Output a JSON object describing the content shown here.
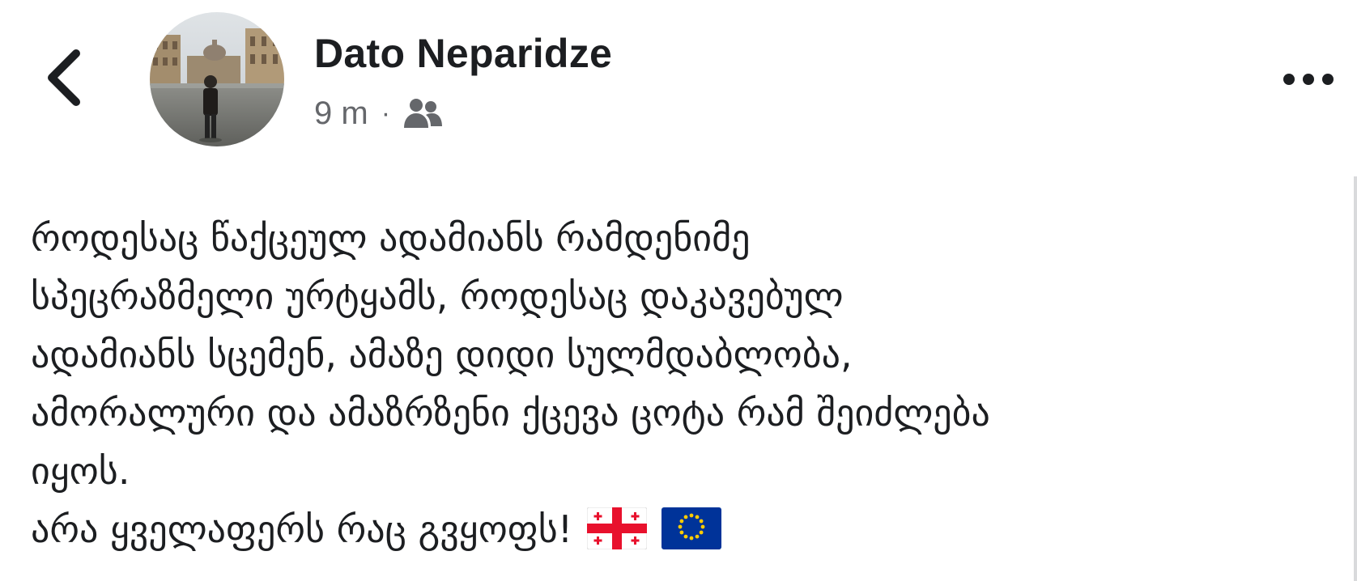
{
  "post": {
    "author": {
      "name": "Dato Neparidze"
    },
    "meta": {
      "time": "9 m",
      "separator": "·",
      "audience_icon": "friends-icon"
    },
    "icons": {
      "back": "chevron-left-icon",
      "more": "more-horizontal-icon"
    },
    "body_lines": [
      "როდესაც წაქცეულ ადამიანს რამდენიმე",
      "სპეცრაზმელი ურტყამს, როდესაც დაკავებულ",
      "ადამიანს სცემენ, ამაზე დიდი სულმდაბლობა,",
      "ამორალური და ამაზრზენი ქცევა ცოტა რამ შეიძლება",
      "იყოს.",
      "არა ყველაფერს რაც გვყოფს!"
    ],
    "flags": [
      "georgia-flag-icon",
      "eu-flag-icon"
    ]
  },
  "colors": {
    "text": "#1c1e21",
    "secondary_text": "#65676b",
    "background": "#ffffff",
    "flag_red": "#e8112d",
    "eu_blue": "#003399",
    "eu_gold": "#ffcc00"
  }
}
